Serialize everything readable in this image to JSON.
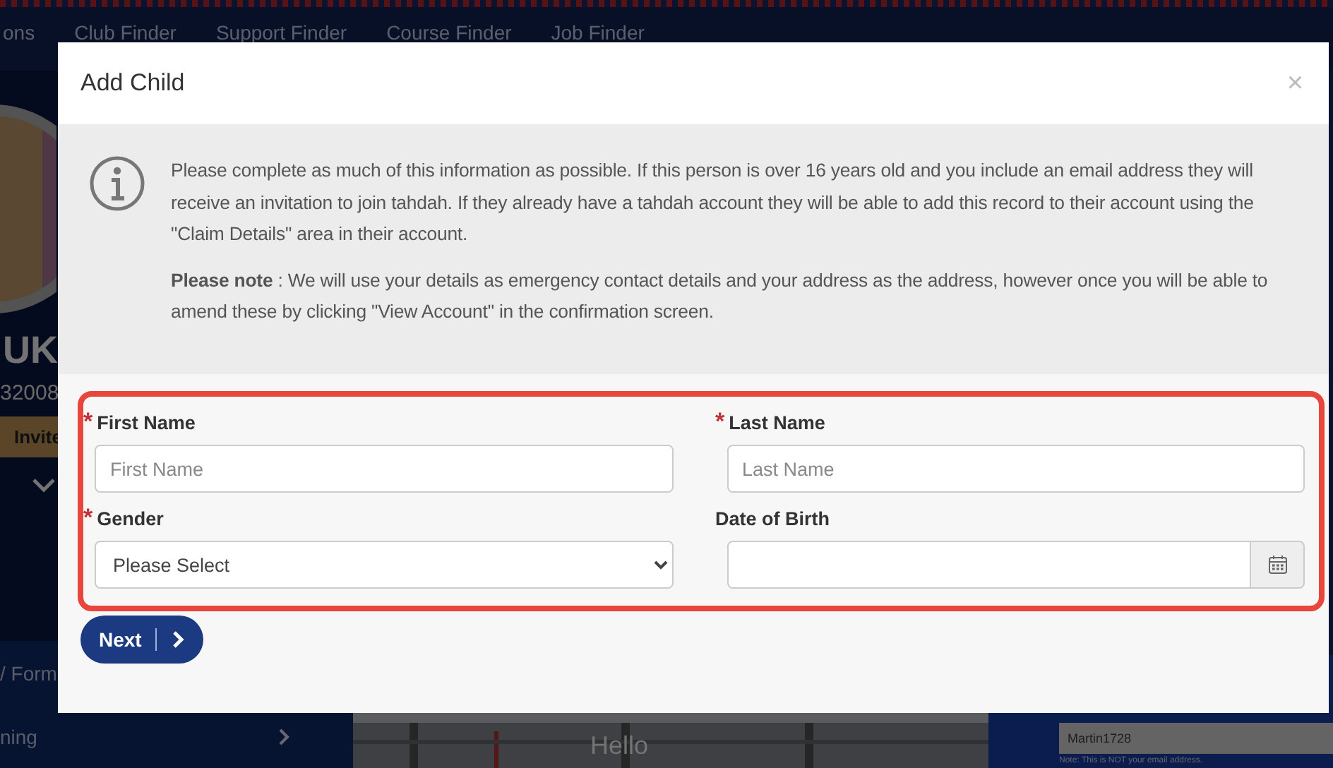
{
  "top_nav": {
    "items": [
      "ons",
      "Club Finder",
      "Support Finder",
      "Course Finder",
      "Job Finder"
    ]
  },
  "sidebar": {
    "name": "UK",
    "number": "32008",
    "badge": "Invite",
    "items": [
      {
        "label": "/ Form",
        "chevron": false
      },
      {
        "label": "ning",
        "chevron": true
      }
    ]
  },
  "hero": {
    "text": "Hello"
  },
  "account_panel": {
    "username": "Martin1728",
    "note": "Note: This is NOT your email address."
  },
  "modal": {
    "title": "Add Child",
    "close": "×",
    "required_mark": "*",
    "info": [
      "Please complete as much of this information as possible. If this person is over 16 years old and you include an email address they will receive an invitation to join tahdah. If they already have a tahdah account they will be able to add this record to their account using the \"Claim Details\" area in their account.",
      "**Please note** : We will use your details as emergency contact details and your address as the address, however once you will be able to amend these by clicking \"View Account\" in the confirmation screen."
    ],
    "fields": [
      {
        "kind": "text",
        "label": "First Name",
        "required": true,
        "placeholder": "First Name"
      },
      {
        "kind": "text",
        "label": "Last Name",
        "required": true,
        "placeholder": "Last Name"
      },
      {
        "kind": "select",
        "label": "Gender",
        "required": true,
        "value": "Please Select"
      },
      {
        "kind": "date",
        "label": "Date of Birth",
        "required": false
      }
    ],
    "next_button": "Next"
  }
}
